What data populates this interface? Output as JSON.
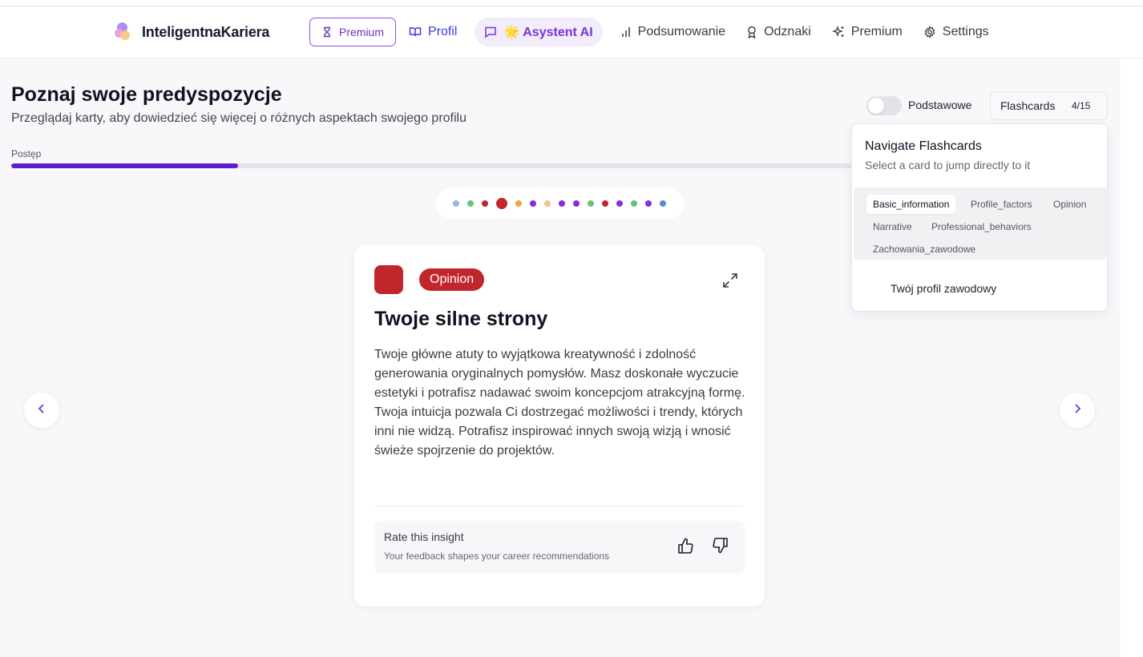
{
  "brand": {
    "name": "InteligentnaKariera"
  },
  "nav": {
    "premium_button": "Premium",
    "profil": "Profil",
    "asystent": "🌟 Asystent AI",
    "podsumowanie": "Podsumowanie",
    "odznaki": "Odznaki",
    "premium": "Premium",
    "settings": "Settings"
  },
  "page": {
    "title": "Poznaj swoje predyspozycje",
    "subtitle": "Przeglądaj karty, aby dowiedzieć się więcej o różnych aspektach swojego profilu",
    "progress_label": "Postęp",
    "progress_fraction": 0.2667
  },
  "dots": [
    {
      "color": "#9fb4e6",
      "active": false
    },
    {
      "color": "#6cc07c",
      "active": false
    },
    {
      "color": "#c2262d",
      "active": false
    },
    {
      "color": "#c2262d",
      "active": true
    },
    {
      "color": "#f0a640",
      "active": false
    },
    {
      "color": "#8a2be2",
      "active": false
    },
    {
      "color": "#f3c58c",
      "active": false
    },
    {
      "color": "#8a2be2",
      "active": false
    },
    {
      "color": "#8a2be2",
      "active": false
    },
    {
      "color": "#6cc07c",
      "active": false
    },
    {
      "color": "#c2262d",
      "active": false
    },
    {
      "color": "#8a2be2",
      "active": false
    },
    {
      "color": "#6cc07c",
      "active": false
    },
    {
      "color": "#8a2be2",
      "active": false
    },
    {
      "color": "#5b8ad6",
      "active": false
    }
  ],
  "card": {
    "badge": "Opinion",
    "accent": "#c2262d",
    "title": "Twoje silne strony",
    "body": "Twoje główne atuty to wyjątkowa kreatywność i zdolność generowania oryginalnych pomysłów. Masz doskonałe wyczucie estetyki i potrafisz nadawać swoim koncepcjom atrakcyjną formę. Twoja intuicja pozwala Ci dostrzegać możliwości i trendy, których inni nie widzą. Potrafisz inspirować innych swoją wizją i wnosić świeże spojrzenie do projektów.",
    "rate_title": "Rate this insight",
    "rate_subtitle": "Your feedback shapes your career recommendations"
  },
  "controls": {
    "toggle_label": "Podstawowe",
    "flashcards_label": "Flashcards",
    "flashcards_count": "4/15"
  },
  "popover": {
    "title": "Navigate Flashcards",
    "subtitle": "Select a card to jump directly to it",
    "tabs": [
      "Basic_information",
      "Profile_factors",
      "Opinion",
      "Narrative",
      "Professional_behaviors",
      "Zachowania_zawodowe"
    ],
    "active_tab": "Basic_information",
    "item": "Twój profil zawodowy"
  }
}
